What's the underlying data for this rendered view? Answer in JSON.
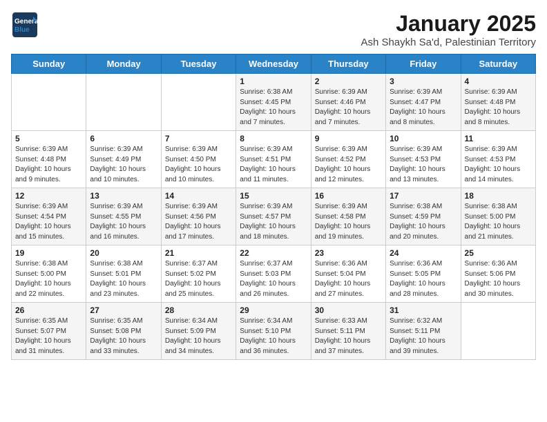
{
  "logo": {
    "line1": "General",
    "line2": "Blue"
  },
  "title": "January 2025",
  "subtitle": "Ash Shaykh Sa'd, Palestinian Territory",
  "days_of_week": [
    "Sunday",
    "Monday",
    "Tuesday",
    "Wednesday",
    "Thursday",
    "Friday",
    "Saturday"
  ],
  "weeks": [
    [
      {
        "day": "",
        "info": ""
      },
      {
        "day": "",
        "info": ""
      },
      {
        "day": "",
        "info": ""
      },
      {
        "day": "1",
        "info": "Sunrise: 6:38 AM\nSunset: 4:45 PM\nDaylight: 10 hours\nand 7 minutes."
      },
      {
        "day": "2",
        "info": "Sunrise: 6:39 AM\nSunset: 4:46 PM\nDaylight: 10 hours\nand 7 minutes."
      },
      {
        "day": "3",
        "info": "Sunrise: 6:39 AM\nSunset: 4:47 PM\nDaylight: 10 hours\nand 8 minutes."
      },
      {
        "day": "4",
        "info": "Sunrise: 6:39 AM\nSunset: 4:48 PM\nDaylight: 10 hours\nand 8 minutes."
      }
    ],
    [
      {
        "day": "5",
        "info": "Sunrise: 6:39 AM\nSunset: 4:48 PM\nDaylight: 10 hours\nand 9 minutes."
      },
      {
        "day": "6",
        "info": "Sunrise: 6:39 AM\nSunset: 4:49 PM\nDaylight: 10 hours\nand 10 minutes."
      },
      {
        "day": "7",
        "info": "Sunrise: 6:39 AM\nSunset: 4:50 PM\nDaylight: 10 hours\nand 10 minutes."
      },
      {
        "day": "8",
        "info": "Sunrise: 6:39 AM\nSunset: 4:51 PM\nDaylight: 10 hours\nand 11 minutes."
      },
      {
        "day": "9",
        "info": "Sunrise: 6:39 AM\nSunset: 4:52 PM\nDaylight: 10 hours\nand 12 minutes."
      },
      {
        "day": "10",
        "info": "Sunrise: 6:39 AM\nSunset: 4:53 PM\nDaylight: 10 hours\nand 13 minutes."
      },
      {
        "day": "11",
        "info": "Sunrise: 6:39 AM\nSunset: 4:53 PM\nDaylight: 10 hours\nand 14 minutes."
      }
    ],
    [
      {
        "day": "12",
        "info": "Sunrise: 6:39 AM\nSunset: 4:54 PM\nDaylight: 10 hours\nand 15 minutes."
      },
      {
        "day": "13",
        "info": "Sunrise: 6:39 AM\nSunset: 4:55 PM\nDaylight: 10 hours\nand 16 minutes."
      },
      {
        "day": "14",
        "info": "Sunrise: 6:39 AM\nSunset: 4:56 PM\nDaylight: 10 hours\nand 17 minutes."
      },
      {
        "day": "15",
        "info": "Sunrise: 6:39 AM\nSunset: 4:57 PM\nDaylight: 10 hours\nand 18 minutes."
      },
      {
        "day": "16",
        "info": "Sunrise: 6:39 AM\nSunset: 4:58 PM\nDaylight: 10 hours\nand 19 minutes."
      },
      {
        "day": "17",
        "info": "Sunrise: 6:38 AM\nSunset: 4:59 PM\nDaylight: 10 hours\nand 20 minutes."
      },
      {
        "day": "18",
        "info": "Sunrise: 6:38 AM\nSunset: 5:00 PM\nDaylight: 10 hours\nand 21 minutes."
      }
    ],
    [
      {
        "day": "19",
        "info": "Sunrise: 6:38 AM\nSunset: 5:00 PM\nDaylight: 10 hours\nand 22 minutes."
      },
      {
        "day": "20",
        "info": "Sunrise: 6:38 AM\nSunset: 5:01 PM\nDaylight: 10 hours\nand 23 minutes."
      },
      {
        "day": "21",
        "info": "Sunrise: 6:37 AM\nSunset: 5:02 PM\nDaylight: 10 hours\nand 25 minutes."
      },
      {
        "day": "22",
        "info": "Sunrise: 6:37 AM\nSunset: 5:03 PM\nDaylight: 10 hours\nand 26 minutes."
      },
      {
        "day": "23",
        "info": "Sunrise: 6:36 AM\nSunset: 5:04 PM\nDaylight: 10 hours\nand 27 minutes."
      },
      {
        "day": "24",
        "info": "Sunrise: 6:36 AM\nSunset: 5:05 PM\nDaylight: 10 hours\nand 28 minutes."
      },
      {
        "day": "25",
        "info": "Sunrise: 6:36 AM\nSunset: 5:06 PM\nDaylight: 10 hours\nand 30 minutes."
      }
    ],
    [
      {
        "day": "26",
        "info": "Sunrise: 6:35 AM\nSunset: 5:07 PM\nDaylight: 10 hours\nand 31 minutes."
      },
      {
        "day": "27",
        "info": "Sunrise: 6:35 AM\nSunset: 5:08 PM\nDaylight: 10 hours\nand 33 minutes."
      },
      {
        "day": "28",
        "info": "Sunrise: 6:34 AM\nSunset: 5:09 PM\nDaylight: 10 hours\nand 34 minutes."
      },
      {
        "day": "29",
        "info": "Sunrise: 6:34 AM\nSunset: 5:10 PM\nDaylight: 10 hours\nand 36 minutes."
      },
      {
        "day": "30",
        "info": "Sunrise: 6:33 AM\nSunset: 5:11 PM\nDaylight: 10 hours\nand 37 minutes."
      },
      {
        "day": "31",
        "info": "Sunrise: 6:32 AM\nSunset: 5:11 PM\nDaylight: 10 hours\nand 39 minutes."
      },
      {
        "day": "",
        "info": ""
      }
    ]
  ]
}
